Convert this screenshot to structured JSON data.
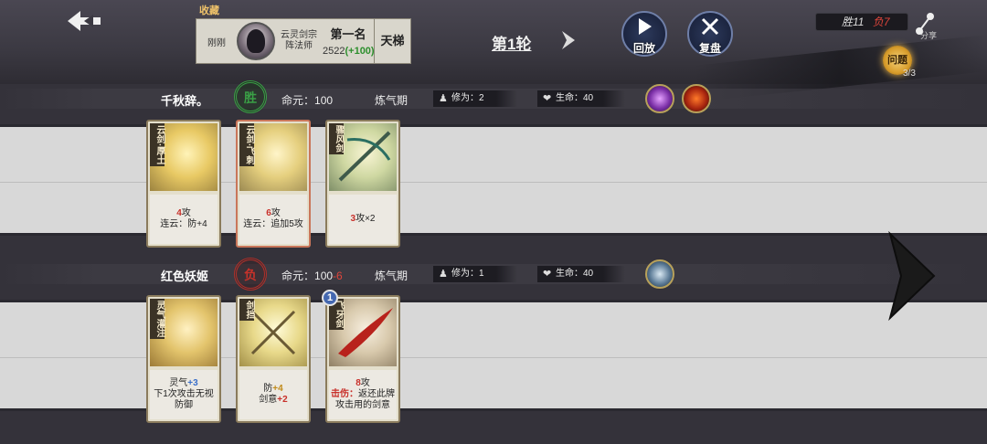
{
  "header": {
    "back_icon": "back-arrow-icon",
    "favorite_label": "收藏",
    "player_card": {
      "status": "刚刚",
      "sect": "云灵剑宗",
      "role": "阵法师",
      "rank_title": "第一名",
      "rating": "2522",
      "rating_delta": "(+100)",
      "mode": "天梯"
    },
    "round_title": "第1轮",
    "replay_label": "回放",
    "review_label": "复盘",
    "score_win": "胜11",
    "score_loss": "负7",
    "node_label": "分享",
    "topic_label": "问题",
    "topic_count": "3/3"
  },
  "players": [
    {
      "name": "千秋辞。",
      "result": "胜",
      "life_label": "命元：",
      "life_value": "100",
      "life_delta": "",
      "realm": "炼气期",
      "cultivation_label": "修为：",
      "cultivation_value": "2",
      "hp_label": "生命：",
      "hp_value": "40",
      "cards": [
        {
          "name": "云剑·厚土",
          "attack": "4",
          "attack_unit": "攻",
          "effect": "连云：防+4",
          "level": ""
        },
        {
          "name": "云剑·飞刺",
          "attack": "6",
          "attack_unit": "攻",
          "effect": "连云：追加5攻",
          "level": ""
        },
        {
          "name": "骤风剑",
          "attack": "3",
          "attack_unit": "攻×2",
          "effect": "",
          "level": ""
        }
      ]
    },
    {
      "name": "红色妖姬",
      "result": "负",
      "life_label": "命元：",
      "life_value": "100",
      "life_delta": "-6",
      "realm": "炼气期",
      "cultivation_label": "修为：",
      "cultivation_value": "1",
      "hp_label": "生命：",
      "hp_value": "40",
      "cards": [
        {
          "name": "灵气灌注",
          "line1_prefix": "灵气",
          "line1_value": "+3",
          "line2": "下1次攻击无视防御",
          "level": ""
        },
        {
          "name": "剑挡",
          "line1_prefix": "防",
          "line1_value": "+4",
          "line2_prefix": "剑意",
          "line2_value": "+2",
          "level": ""
        },
        {
          "name": "飞牙剑",
          "attack": "8",
          "attack_unit": "攻",
          "effect_label": "击伤：",
          "effect": "返还此牌攻击用的剑意",
          "level": "1"
        }
      ]
    }
  ],
  "colors": {
    "win": "#3aa046",
    "lose": "#c7322a",
    "accent_gold": "#d89d2b"
  }
}
